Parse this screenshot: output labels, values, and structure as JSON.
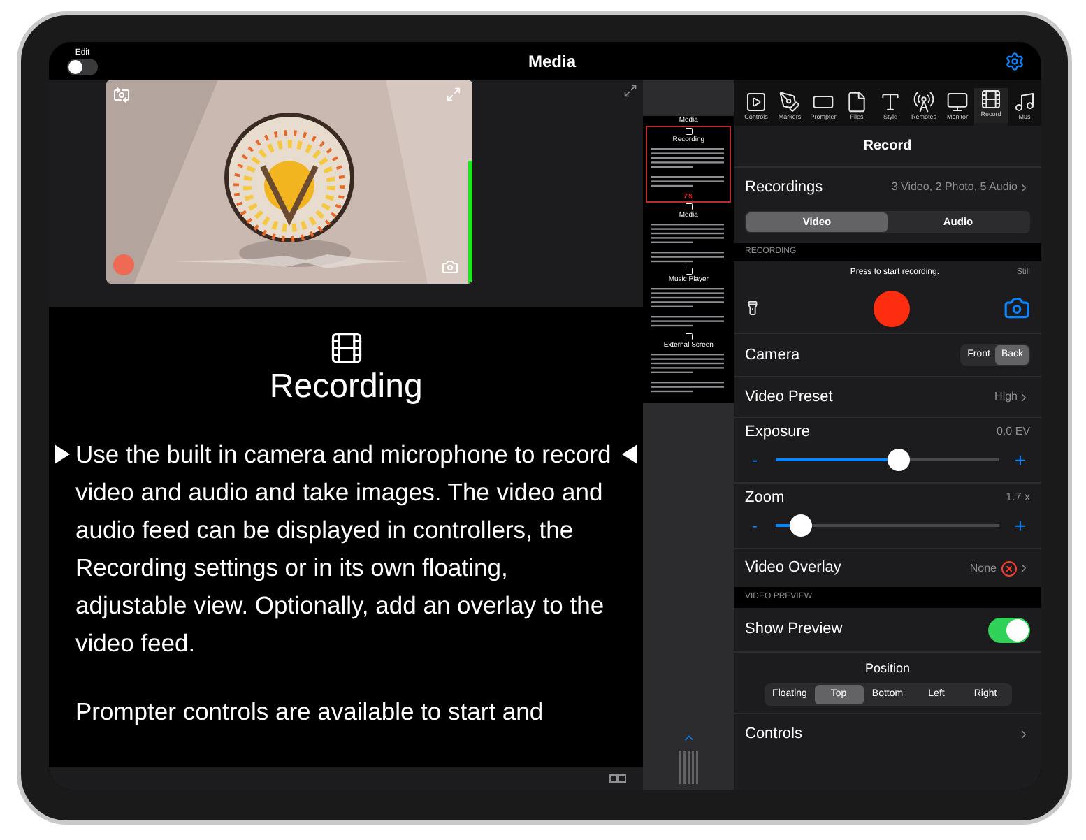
{
  "top_bar": {
    "edit_label": "Edit",
    "edit_toggle": {
      "on": false
    },
    "title": "Media"
  },
  "preview": {
    "meter": {
      "level": 0.6
    }
  },
  "script": {
    "heading": "Recording",
    "paragraphs": [
      "Use the built in camera and microphone to record video and audio and take images. The video and audio feed can be displayed in controllers, the Recording settings or in its own floating, adjustable view. Optionally, add an overlay to the video feed.",
      "Prompter controls are available to start and"
    ]
  },
  "minimap": {
    "progress": "7%",
    "sections": [
      {
        "kind": "title",
        "heading": "Media"
      },
      {
        "kind": "section",
        "heading": "Recording"
      },
      {
        "kind": "section",
        "heading": "Media"
      },
      {
        "kind": "section",
        "heading": "Music Player"
      },
      {
        "kind": "section",
        "heading": "External Screen"
      }
    ]
  },
  "tools": [
    {
      "label": "Controls",
      "selected": false
    },
    {
      "label": "Markers",
      "selected": false
    },
    {
      "label": "Prompter",
      "selected": false
    },
    {
      "label": "Files",
      "selected": false
    },
    {
      "label": "Style",
      "selected": false
    },
    {
      "label": "Remotes",
      "selected": false
    },
    {
      "label": "Monitor",
      "selected": false
    },
    {
      "label": "Record",
      "selected": true
    },
    {
      "label": "Mus",
      "selected": false
    }
  ],
  "panel": {
    "title": "Record",
    "recordings": {
      "label": "Recordings",
      "value": "3 Video, 2 Photo, 5 Audio"
    },
    "mode_tabs": [
      {
        "label": "Video",
        "selected": true
      },
      {
        "label": "Audio",
        "selected": false
      }
    ],
    "recording_header": "RECORDING",
    "record_hint": "Press to start recording.",
    "still_label": "Still",
    "camera": {
      "label": "Camera",
      "options": [
        {
          "label": "Front",
          "selected": false
        },
        {
          "label": "Back",
          "selected": true
        }
      ]
    },
    "video_preset": {
      "label": "Video Preset",
      "value": "High"
    },
    "exposure": {
      "label": "Exposure",
      "reading": "0.0 EV",
      "level": 0.55,
      "minus": "-",
      "plus": "+"
    },
    "zoom": {
      "label": "Zoom",
      "reading": "1.7 x",
      "level": 0.11,
      "minus": "-",
      "plus": "+"
    },
    "video_overlay": {
      "label": "Video Overlay",
      "value": "None"
    },
    "preview_header": "VIDEO PREVIEW",
    "show_preview": {
      "label": "Show Preview",
      "on": true
    },
    "position": {
      "label": "Position",
      "options": [
        {
          "label": "Floating",
          "selected": false
        },
        {
          "label": "Top",
          "selected": true
        },
        {
          "label": "Bottom",
          "selected": false
        },
        {
          "label": "Left",
          "selected": false
        },
        {
          "label": "Right",
          "selected": false
        }
      ]
    },
    "controls": {
      "label": "Controls"
    }
  }
}
